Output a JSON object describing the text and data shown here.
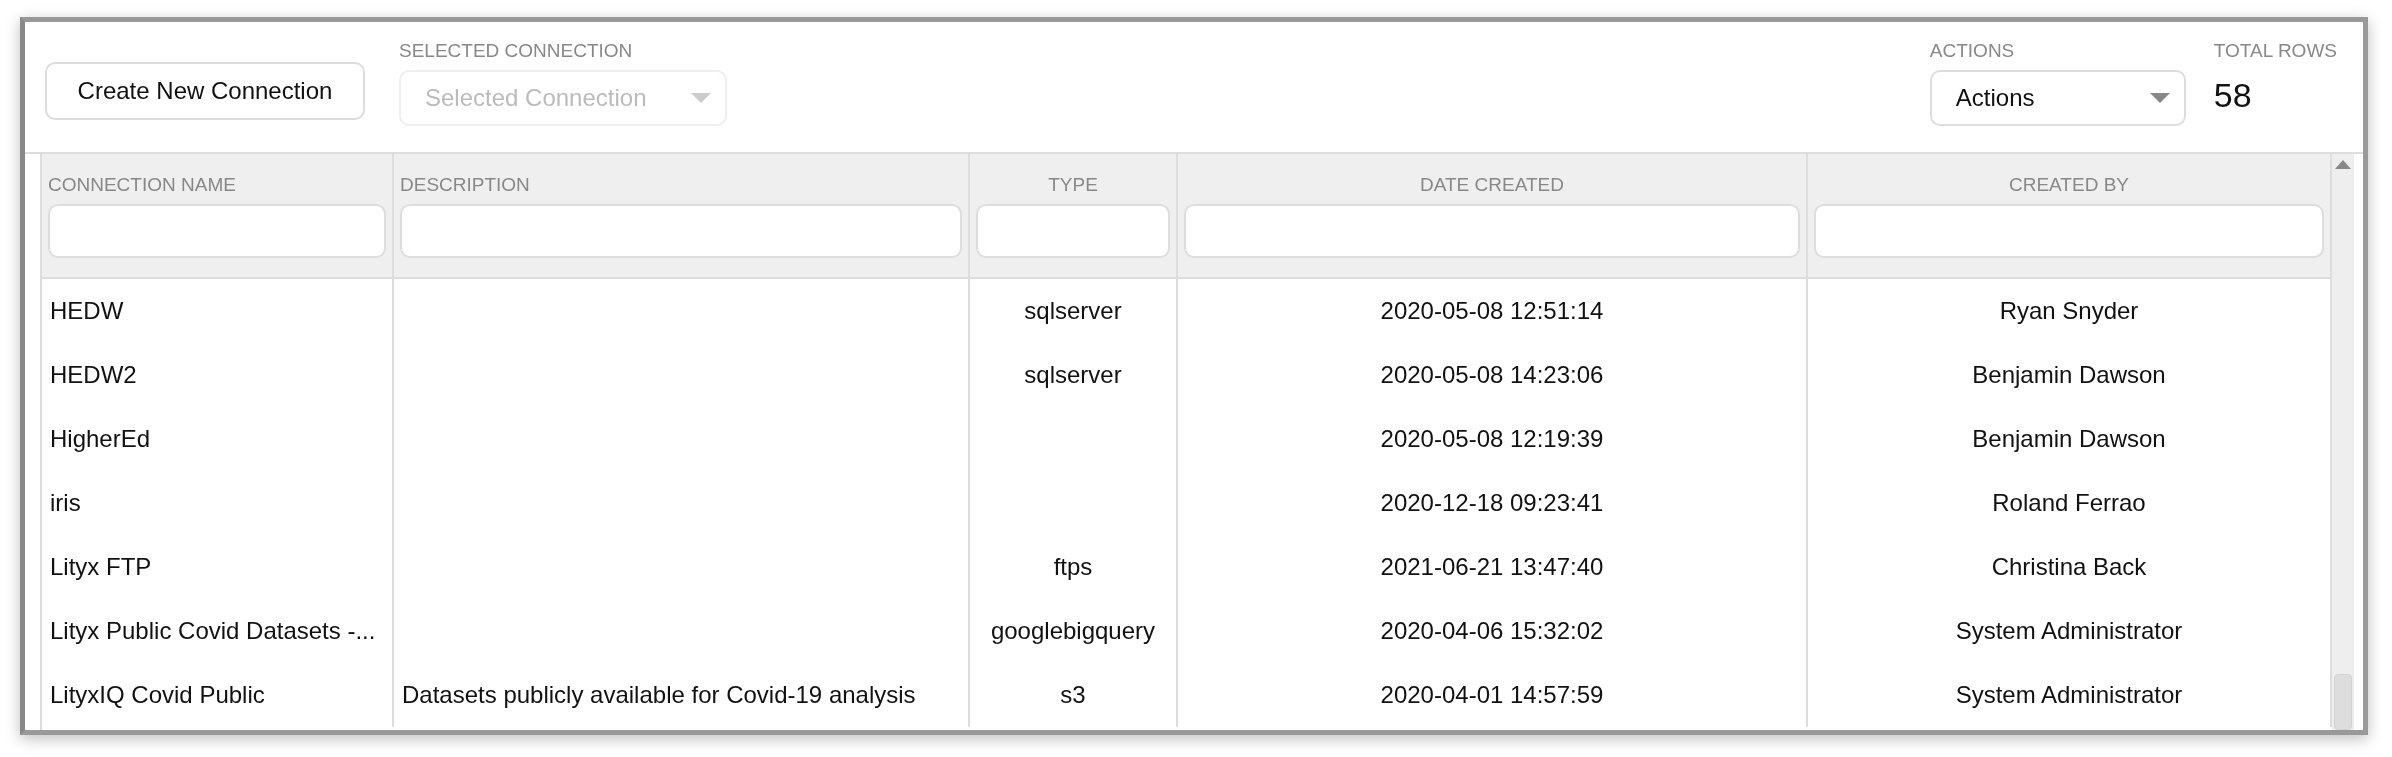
{
  "toolbar": {
    "create_button": "Create New Connection",
    "selected_connection": {
      "label": "SELECTED CONNECTION",
      "placeholder": "Selected Connection",
      "disabled": true
    },
    "actions": {
      "label": "ACTIONS",
      "value": "Actions"
    },
    "total_rows": {
      "label": "TOTAL ROWS",
      "value": "58"
    }
  },
  "table": {
    "columns": [
      {
        "label": "CONNECTION NAME"
      },
      {
        "label": "DESCRIPTION"
      },
      {
        "label": "TYPE"
      },
      {
        "label": "DATE CREATED"
      },
      {
        "label": "CREATED BY"
      }
    ],
    "rows": [
      [
        "HEDW",
        "",
        "sqlserver",
        "2020-05-08 12:51:14",
        "Ryan Snyder"
      ],
      [
        "HEDW2",
        "",
        "sqlserver",
        "2020-05-08 14:23:06",
        "Benjamin Dawson"
      ],
      [
        "HigherEd",
        "",
        "",
        "2020-05-08 12:19:39",
        "Benjamin Dawson"
      ],
      [
        "iris",
        "",
        "",
        "2020-12-18 09:23:41",
        "Roland Ferrao"
      ],
      [
        "Lityx FTP",
        "",
        "ftps",
        "2021-06-21 13:47:40",
        "Christina Back"
      ],
      [
        "Lityx Public Covid Datasets -...",
        "",
        "googlebigquery",
        "2020-04-06 15:32:02",
        "System Administrator"
      ],
      [
        "LityxIQ Covid Public",
        "Datasets publicly available for Covid-19 analysis",
        "s3",
        "2020-04-01 14:57:59",
        "System Administrator"
      ]
    ]
  }
}
